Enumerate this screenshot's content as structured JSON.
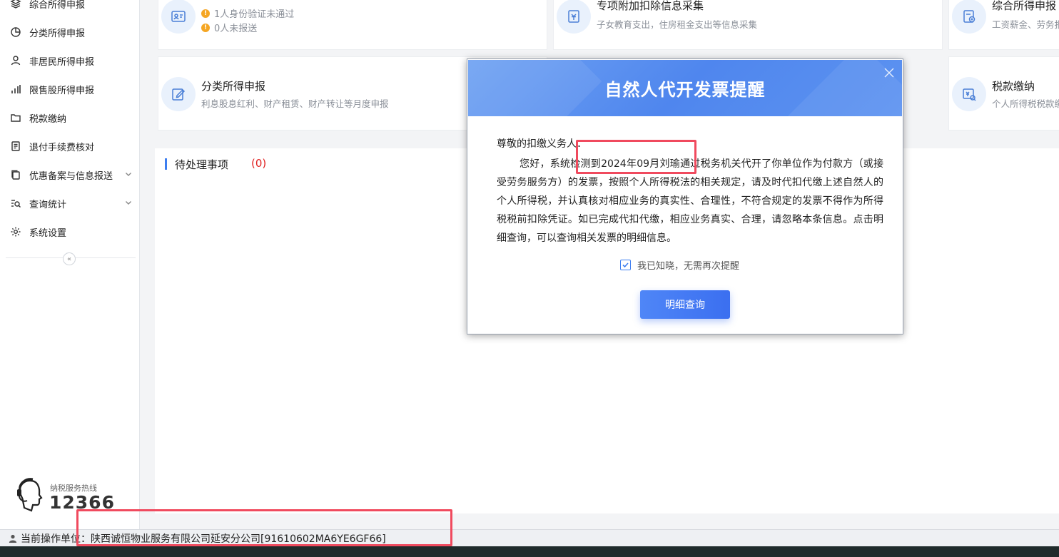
{
  "sidebar": {
    "items": [
      {
        "label": "综合所得申报",
        "icon": "layers-icon"
      },
      {
        "label": "分类所得申报",
        "icon": "pie-chart-icon"
      },
      {
        "label": "非居民所得申报",
        "icon": "user-icon"
      },
      {
        "label": "限售股所得申报",
        "icon": "bar-chart-icon"
      },
      {
        "label": "税款缴纳",
        "icon": "folder-icon"
      },
      {
        "label": "退付手续费核对",
        "icon": "document-list-icon"
      },
      {
        "label": "优惠备案与信息报送",
        "icon": "copy-icon"
      },
      {
        "label": "查询统计",
        "icon": "search-list-icon"
      },
      {
        "label": "系统设置",
        "icon": "gear-icon"
      }
    ],
    "hotline_label": "纳税服务热线",
    "hotline_number": "12366"
  },
  "cards": {
    "id_check": {
      "warn1": "1人身份验证未通过",
      "warn2": "0人未报送"
    },
    "special_deduction": {
      "title": "专项附加扣除信息采集",
      "desc": "子女教育支出，住房租金支出等信息采集"
    },
    "comprehensive": {
      "title": "综合所得申报",
      "desc": "工资薪金、劳务报"
    },
    "classified": {
      "title": "分类所得申报",
      "desc": "利息股息红利、财产租赁、财产转让等月度申报"
    },
    "tax_payment": {
      "title": "税款缴纳",
      "desc": "个人所得税税款缴"
    }
  },
  "pending": {
    "title": "待处理事项",
    "count": "(0)"
  },
  "modal": {
    "title": "自然人代开发票提醒",
    "greeting": "尊敬的扣缴义务人：",
    "body": "您好，系统检测到2024年09月刘瑜通过税务机关代开了你单位作为付款方（或接受劳务服务方）的发票，按照个人所得税法的相关规定，请及时代扣代缴上述自然人的个人所得税，并认真核对相应业务的真实性、合理性，不符合规定的发票不得作为所得税税前扣除凭证。如已完成代扣代缴，相应业务真实、合理，请忽略本条信息。点击明细查询，可以查询相关发票的明细信息。",
    "acknowledge": "我已知晓，无需再次提醒",
    "detail_button": "明细查询"
  },
  "statusbar": {
    "text": "当前操作单位：陕西诚恒物业服务有限公司延安分公司[91610602MA6YE6GF66]"
  },
  "colors": {
    "accent": "#3d7ef0",
    "warning": "#f5a623",
    "highlight": "#f04a5e",
    "count_red": "#e02020"
  }
}
